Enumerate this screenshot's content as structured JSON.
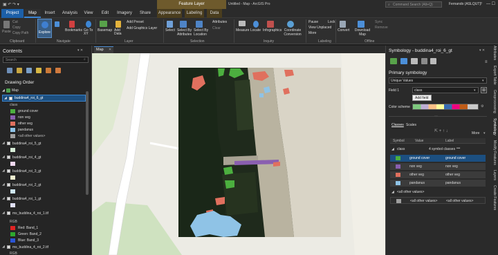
{
  "title_bar": {
    "layer_context_tab": "Feature Layer",
    "document_title": "Untitled - Map - ArcGIS Pro",
    "search_placeholder": "Command Search (Alt+Q)",
    "user": "Fernando (ASLQUT)",
    "help": "?"
  },
  "tabs": [
    "Project",
    "Map",
    "Insert",
    "Analysis",
    "View",
    "Edit",
    "Imagery",
    "Share",
    "Appearance",
    "Labeling",
    "Data"
  ],
  "ribbon": {
    "clipboard": {
      "group": "Clipboard",
      "paste": "Paste",
      "cut": "Cut",
      "copy": "Copy",
      "copy_path": "Copy Path"
    },
    "navigate": {
      "group": "Navigate",
      "explore": "Explore",
      "bookmarks": "Bookmarks",
      "goto": "Go To XY"
    },
    "layer": {
      "group": "Layer",
      "basemap": "Basemap",
      "add_data": "Add Data",
      "add_preset": "Add Preset",
      "add_graphics": "Add Graphics Layer"
    },
    "selection": {
      "group": "Selection",
      "select": "Select",
      "by_attributes": "Select By Attributes",
      "by_location": "Select By Location",
      "attributes": "Attributes",
      "clear": "Clear"
    },
    "inquiry": {
      "group": "Inquiry",
      "measure": "Measure",
      "locate": "Locate",
      "infographics": "Infographics",
      "coordinate_conversion": "Coordinate Conversion"
    },
    "labeling": {
      "group": "Labeling",
      "pause": "Pause",
      "view_unplaced": "View Unplaced",
      "lock": "Lock",
      "more": "More"
    },
    "offline": {
      "group": "Offline",
      "convert": "Convert",
      "download_map": "Download Map",
      "sync": "Sync",
      "remove": "Remove"
    }
  },
  "contents": {
    "title": "Contents",
    "search_placeholder": "Search",
    "drawing_order": "Drawing Order",
    "map": "Map",
    "layers": [
      {
        "name": "buddina4_roi_6_gt",
        "field": "class",
        "classes": [
          {
            "label": "ground cover",
            "color": "#4caf3f"
          },
          {
            "label": "non veg",
            "color": "#8a5fb0"
          },
          {
            "label": "other veg",
            "color": "#e0705e"
          },
          {
            "label": "pandanus",
            "color": "#8fc3e6"
          }
        ],
        "other": "<all other values>"
      },
      {
        "name": "buddina4_roi_5_gt",
        "swatch": "#d8efd8"
      },
      {
        "name": "buddina4_roi_4_gt",
        "swatch": "#f1d8f1"
      },
      {
        "name": "buddina4_roi_3_gt",
        "swatch": "#f0f0cf"
      },
      {
        "name": "buddina4_roi_2_gt",
        "swatch": "#cfe8f5"
      },
      {
        "name": "buddina4_roi_1_gt",
        "swatch": "#e0e0f6"
      }
    ],
    "raster": {
      "name": "ms_buddina_4_roi_1.tif",
      "type": "RGB",
      "bands": [
        {
          "label": "Red:  Band_1",
          "color": "#e02424"
        },
        {
          "label": "Green: Band_2",
          "color": "#2ea82e"
        },
        {
          "label": "Blue:  Band_3",
          "color": "#2b55d6"
        }
      ]
    },
    "raster2": {
      "name": "ms_buddina_4_roi_2.tif",
      "type": "RGB"
    }
  },
  "map_tab": "Map",
  "symbology": {
    "title": "Symbology - buddina4_roi_6_gt",
    "primary": "Primary symbology",
    "method": "Unique Values",
    "field1_label": "Field 1",
    "field1_value": "class",
    "add_field_tooltip": "Add field",
    "color_scheme_label": "Color scheme",
    "subtabs": [
      "Classes",
      "Scales"
    ],
    "more": "More",
    "columns": [
      "Symbol",
      "Value",
      "Label"
    ],
    "group_label": "class",
    "group_count": "4 symbol classes",
    "rows": [
      {
        "value": "ground cover",
        "label": "ground cover",
        "color": "#4caf3f"
      },
      {
        "value": "non veg",
        "label": "non veg",
        "color": "#8a5fb0"
      },
      {
        "value": "other veg",
        "label": "other veg",
        "color": "#e0705e"
      },
      {
        "value": "pandanus",
        "label": "pandanus",
        "color": "#8fc3e6"
      }
    ],
    "other_heading": "<all other values>",
    "other_row": {
      "value": "<all other values>",
      "label": "<all other values>",
      "color": "#9e9e9e"
    }
  },
  "side_tabs": [
    "Attributes",
    "Export Table",
    "Geoprocessing",
    "Symbology",
    "Modify Features",
    "Layers",
    "Create Features"
  ]
}
